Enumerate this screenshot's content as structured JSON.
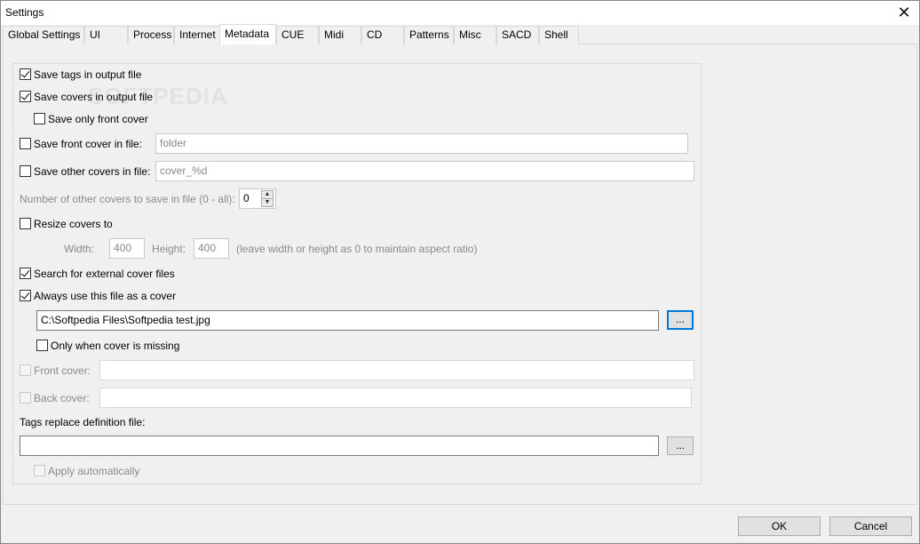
{
  "window": {
    "title": "Settings",
    "close_glyph": "✕"
  },
  "tabs": [
    {
      "label": "Global Settings"
    },
    {
      "label": "UI"
    },
    {
      "label": "Process"
    },
    {
      "label": "Internet"
    },
    {
      "label": "Metadata"
    },
    {
      "label": "CUE"
    },
    {
      "label": "Midi"
    },
    {
      "label": "CD"
    },
    {
      "label": "Patterns"
    },
    {
      "label": "Misc"
    },
    {
      "label": "SACD"
    },
    {
      "label": "Shell"
    }
  ],
  "active_tab": "Metadata",
  "watermark": "SOFTPEDIA",
  "metadata": {
    "save_tags": {
      "label": "Save tags in output file",
      "checked": true
    },
    "save_covers": {
      "label": "Save covers in output file",
      "checked": true
    },
    "save_only_front": {
      "label": "Save only front cover",
      "checked": false
    },
    "save_front_cover_file": {
      "label": "Save front cover in file:",
      "checked": false,
      "value": "folder"
    },
    "save_other_covers_file": {
      "label": "Save other covers in file:",
      "checked": false,
      "value": "cover_%d"
    },
    "num_other_covers": {
      "label": "Number of other covers to save in file (0 - all):",
      "value": "0"
    },
    "resize_covers": {
      "label": "Resize covers to",
      "checked": false
    },
    "width": {
      "label": "Width:",
      "value": "400"
    },
    "height": {
      "label": "Height:",
      "value": "400"
    },
    "resize_hint": "(leave width or height as 0 to maintain aspect ratio)",
    "search_external": {
      "label": "Search for external cover files",
      "checked": true
    },
    "always_use_file": {
      "label": "Always use this file as a cover",
      "checked": true
    },
    "cover_path": "C:\\Softpedia Files\\Softpedia test.jpg",
    "browse_label": "...",
    "only_when_missing": {
      "label": "Only when cover is missing",
      "checked": false
    },
    "front_cover": {
      "label": "Front cover:",
      "checked": false,
      "value": ""
    },
    "back_cover": {
      "label": "Back cover:",
      "checked": false,
      "value": ""
    },
    "tags_replace_label": "Tags replace definition file:",
    "tags_replace_value": "",
    "apply_automatically": {
      "label": "Apply automatically",
      "checked": false
    }
  },
  "footer": {
    "ok_label": "OK",
    "cancel_label": "Cancel"
  }
}
